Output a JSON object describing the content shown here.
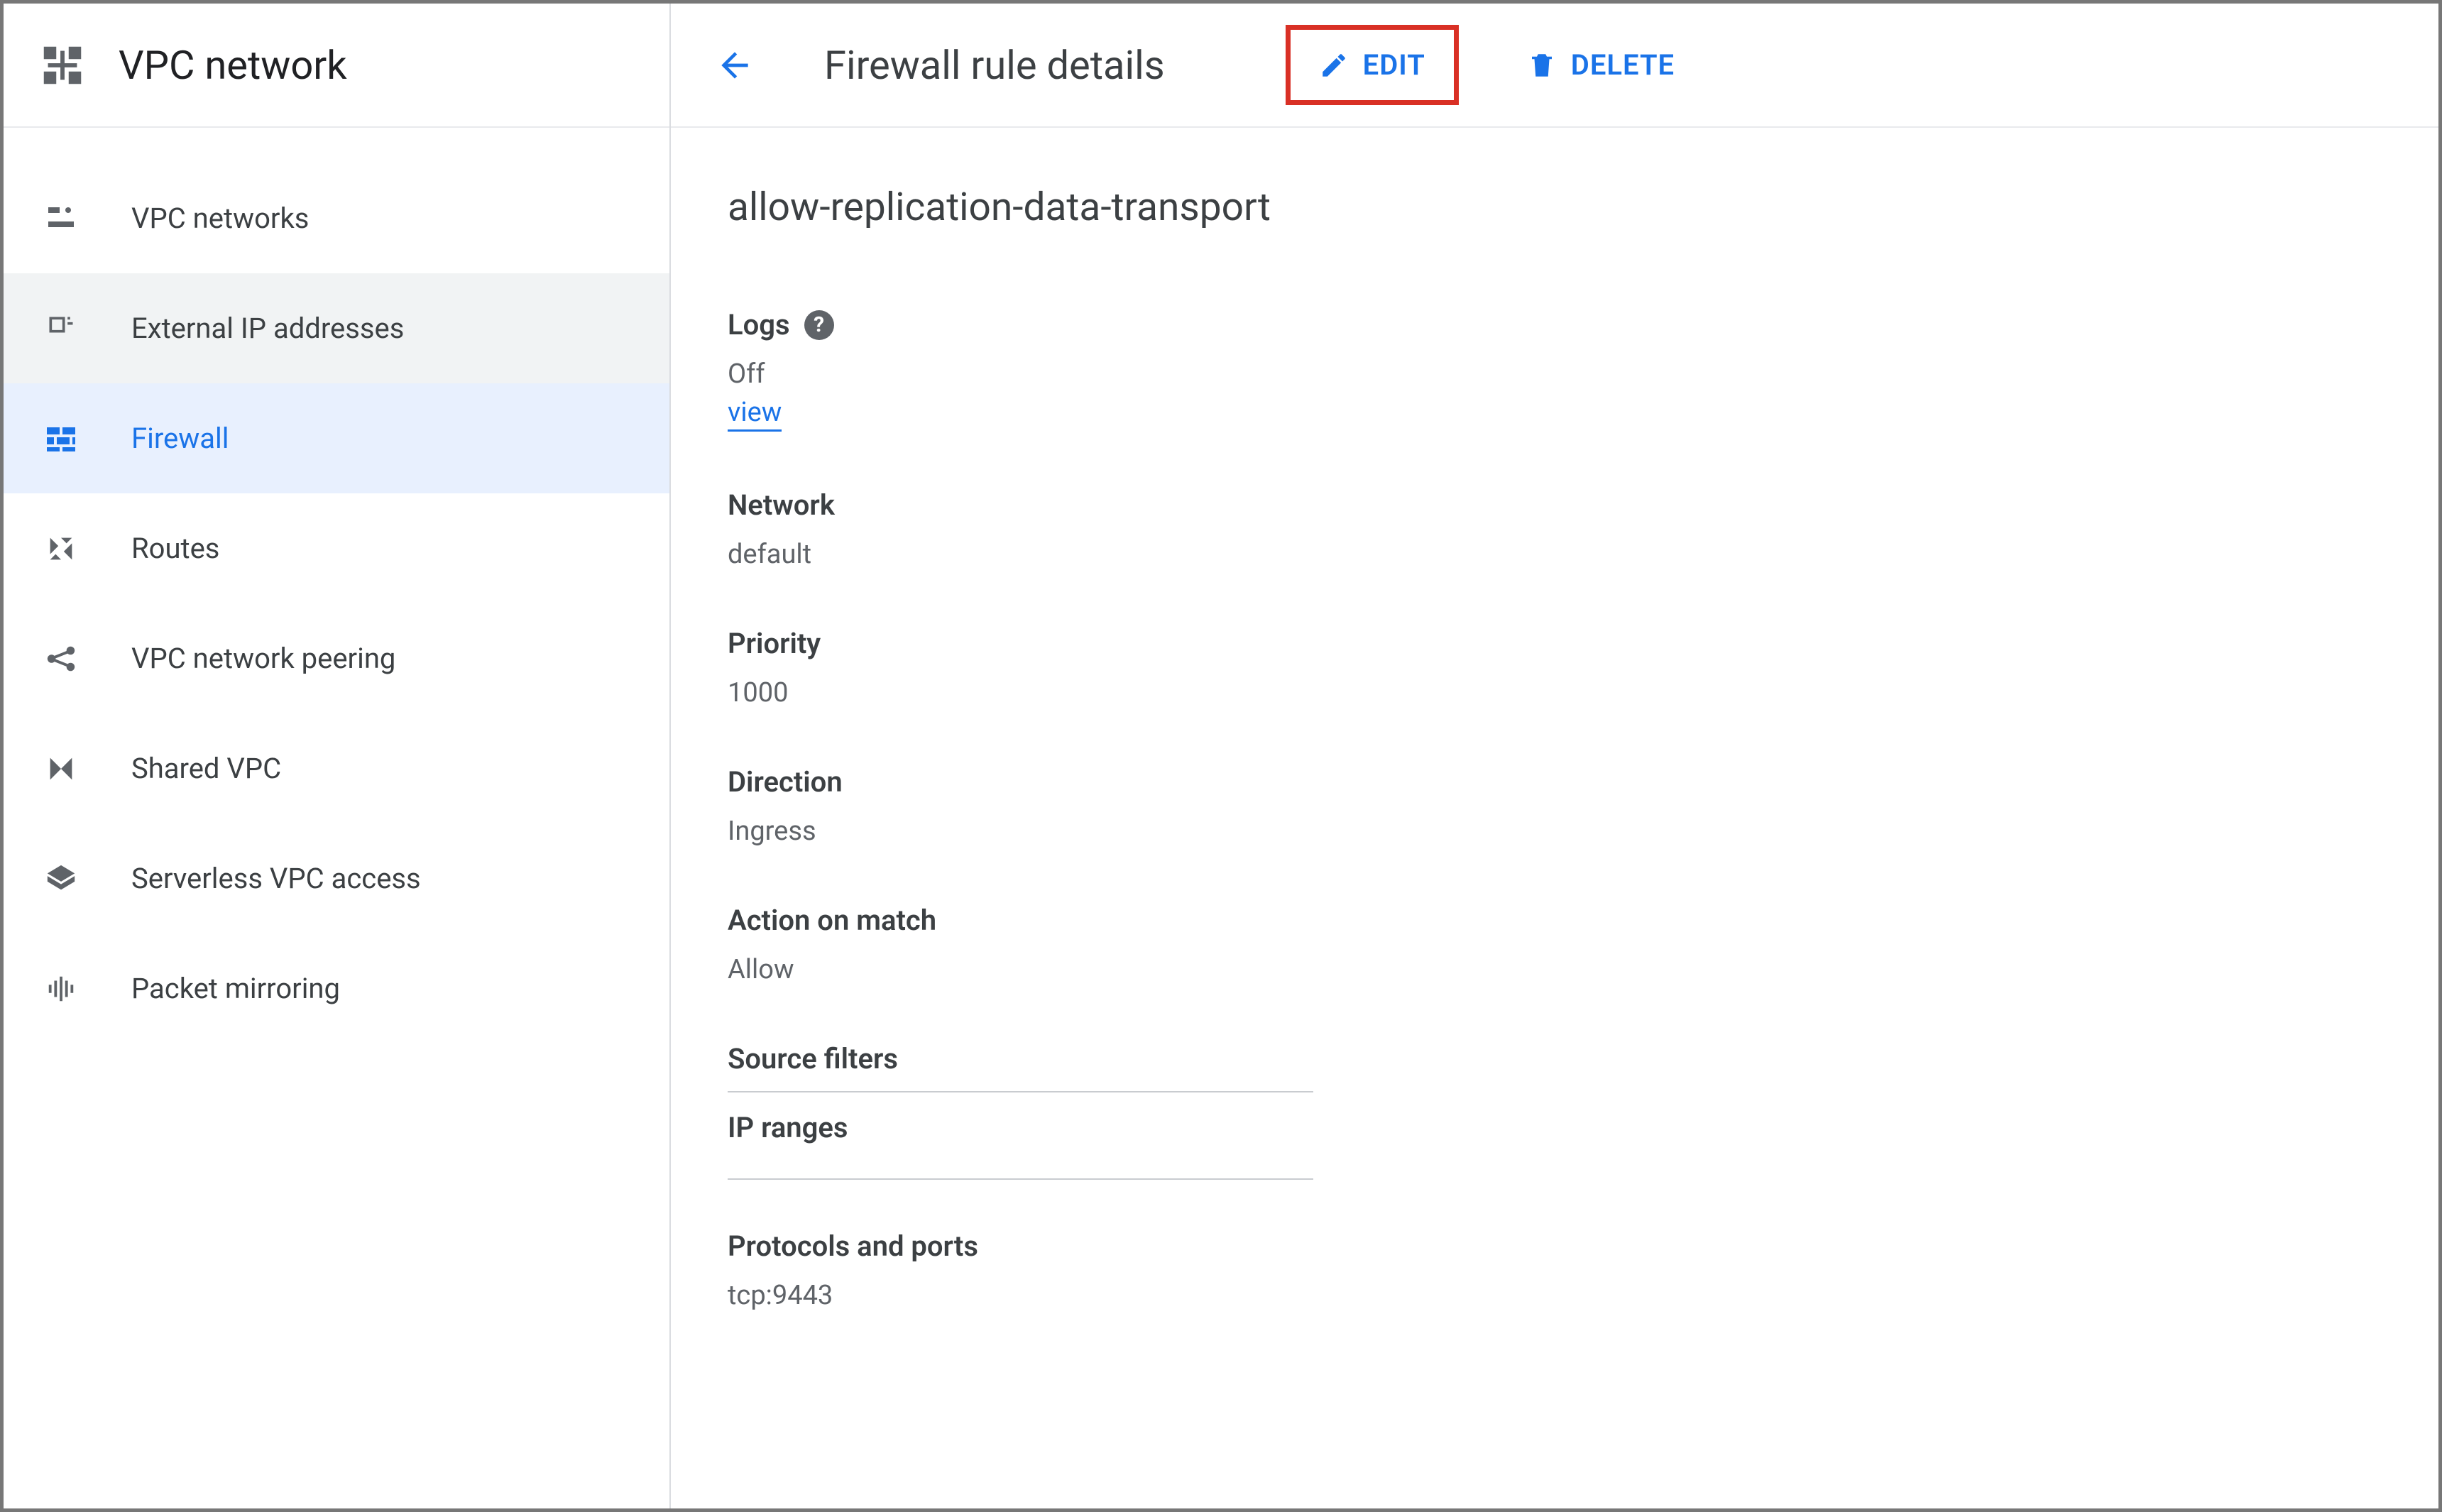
{
  "product": {
    "title": "VPC network"
  },
  "sidebar": {
    "items": [
      {
        "label": "VPC networks",
        "key": "vpc-networks"
      },
      {
        "label": "External IP addresses",
        "key": "external-ip"
      },
      {
        "label": "Firewall",
        "key": "firewall"
      },
      {
        "label": "Routes",
        "key": "routes"
      },
      {
        "label": "VPC network peering",
        "key": "peering"
      },
      {
        "label": "Shared VPC",
        "key": "shared-vpc"
      },
      {
        "label": "Serverless VPC access",
        "key": "serverless"
      },
      {
        "label": "Packet mirroring",
        "key": "mirroring"
      }
    ]
  },
  "header": {
    "title": "Firewall rule details",
    "edit": "EDIT",
    "delete": "DELETE"
  },
  "rule": {
    "name": "allow-replication-data-transport",
    "logs_label": "Logs",
    "logs_value": "Off",
    "logs_link": "view",
    "network_label": "Network",
    "network_value": "default",
    "priority_label": "Priority",
    "priority_value": "1000",
    "direction_label": "Direction",
    "direction_value": "Ingress",
    "action_label": "Action on match",
    "action_value": "Allow",
    "source_filters_label": "Source filters",
    "ip_ranges_label": "IP ranges",
    "protocols_label": "Protocols and ports",
    "protocols_value": "tcp:9443"
  }
}
